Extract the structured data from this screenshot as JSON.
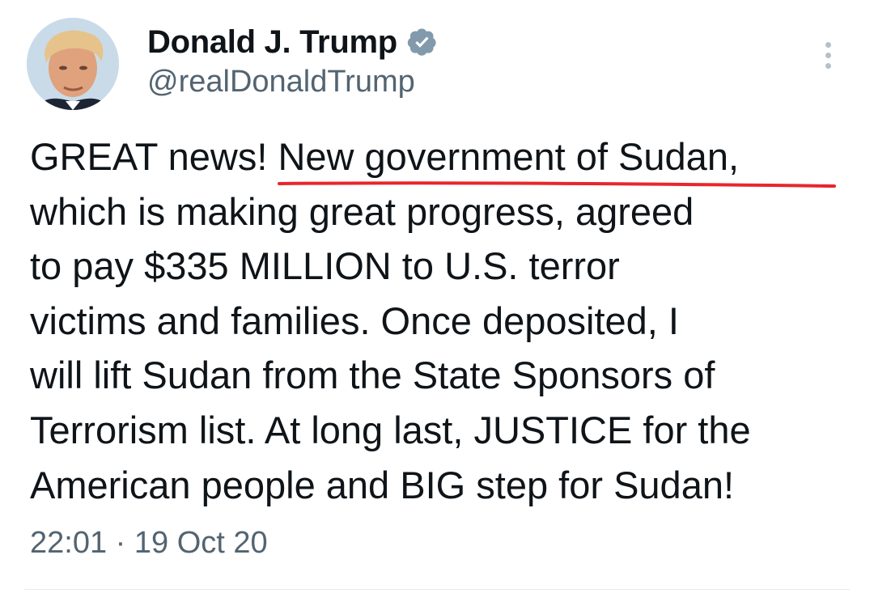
{
  "author": {
    "display_name": "Donald J. Trump",
    "handle": "@realDonaldTrump",
    "verified": true,
    "avatar_icon": "profile-photo",
    "verified_icon": "verified-badge-icon"
  },
  "tweet": {
    "lines": [
      "GREAT news! New government of Sudan,",
      "which is making great progress, agreed",
      "to pay $335 MILLION to U.S. terror",
      "victims and families. Once deposited, I",
      "will lift Sudan from the State Sponsors of",
      "Terrorism list. At long last, JUSTICE for the",
      "American people and BIG step for Sudan!"
    ],
    "timestamp": "22:01 · 19 Oct 20"
  },
  "annotation": {
    "underlined_text": "New government of Sudan,",
    "color": "#e8262c"
  },
  "colors": {
    "text_primary": "#0f1419",
    "text_secondary": "#536471",
    "verified_blue": "#1d9bf0"
  },
  "more_icon": "more-vertical-icon"
}
